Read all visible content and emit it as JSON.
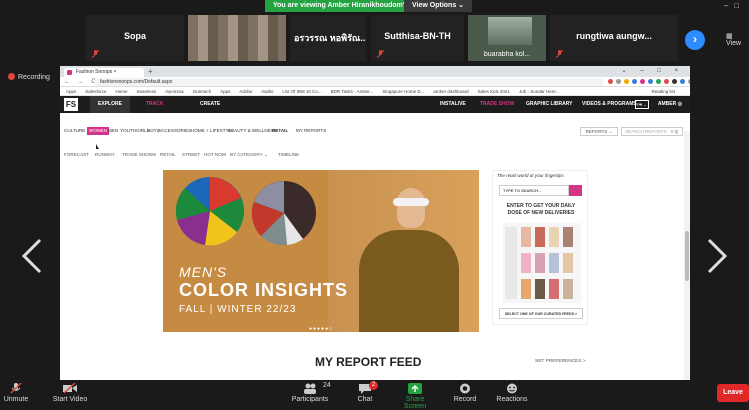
{
  "banner": {
    "viewing_text": "You are viewing Amber Hiranikhoudom's screen",
    "view_options": "View Options ⌄"
  },
  "participants": [
    {
      "name": "Sopa"
    },
    {
      "name": "อรวรรณ หอพิรัณ..."
    },
    {
      "name": "Sutthisa-BN-TH"
    },
    {
      "name": "buarabha kol..."
    },
    {
      "name": "rungtiwa aungw..."
    }
  ],
  "strip": {
    "view_label": "View"
  },
  "recording": {
    "label": "Recording"
  },
  "browser": {
    "tab_title": "Fashion Snoops",
    "url": "fashionsnoops.com/Default.aspx",
    "bookmarks": [
      "Apps",
      "Salesforce",
      "Home",
      "Seamless",
      "myomnia",
      "Outreach",
      "Apps",
      "Adobe",
      "mailto",
      "List Of IBM 10 Co...",
      "BDR Tasks - Amber...",
      "Singapore Home D...",
      "amber dashboard",
      "Sales Kick 2021",
      "Job - Sundar Here..."
    ],
    "reading_list": "Reading list"
  },
  "site": {
    "logo": "FS",
    "nav": [
      "EXPLORE",
      "TRACK",
      "CREATE"
    ],
    "nav_right": [
      "INSTALIVE",
      "TRADE SHOW",
      "GRAPHIC LIBRARY",
      "VIDEOS & PROGRAMS ⌄"
    ],
    "region": "FR ⌄",
    "user": "AMBER",
    "categories": [
      "CULTURE",
      "WOMEN",
      "MEN",
      "YOUTH",
      "GIRLS",
      "BOYS",
      "ACCESSORIES",
      "HOME + LIFESTYLE",
      "BEAUTY & WELLNESS",
      "RETAIL",
      "MY REPORTS"
    ],
    "reports_dropdown": "REPORTS ⌄",
    "search_placeholder": "SEARCH REPORTS",
    "search_clear": "× Q",
    "subnav": [
      "FORECAST",
      "RUNWAY",
      "TRADE SHOWS",
      "RETAIL",
      "STREET",
      "HOT NOW",
      "BY CATEGORY ⌄",
      "TIMELINE"
    ]
  },
  "hero": {
    "line1": "MEN'S",
    "line2": "COLOR INSIGHTS",
    "line3": "FALL | WINTER 22/23",
    "dots": "●●●●●○"
  },
  "panel": {
    "tagline": "The retail world at your fingertips",
    "search_placeholder": "TYPE TO SEARCH...",
    "enter_line1": "ENTER TO GET YOUR DAILY",
    "enter_line2": "DOSE OF NEW DELIVERIES",
    "select_feed": "SELECT ONE OF OUR CURATED FEEDS  >"
  },
  "feed": {
    "title": "MY REPORT FEED",
    "set_prefs": "SET PREFERENCES  >"
  },
  "toolbar": {
    "unmute": "Unmute",
    "start_video": "Start Video",
    "participants_count": "24",
    "participants": "Participants",
    "chat": "Chat",
    "chat_badge": "2",
    "share_screen": "Share Screen",
    "record": "Record",
    "reactions": "Reactions",
    "leave": "Leave"
  },
  "colors": {
    "zoom_green": "#25a242",
    "zoom_blue": "#2d8cff",
    "brand_pink": "#d4358b",
    "leave_red": "#e02828"
  }
}
